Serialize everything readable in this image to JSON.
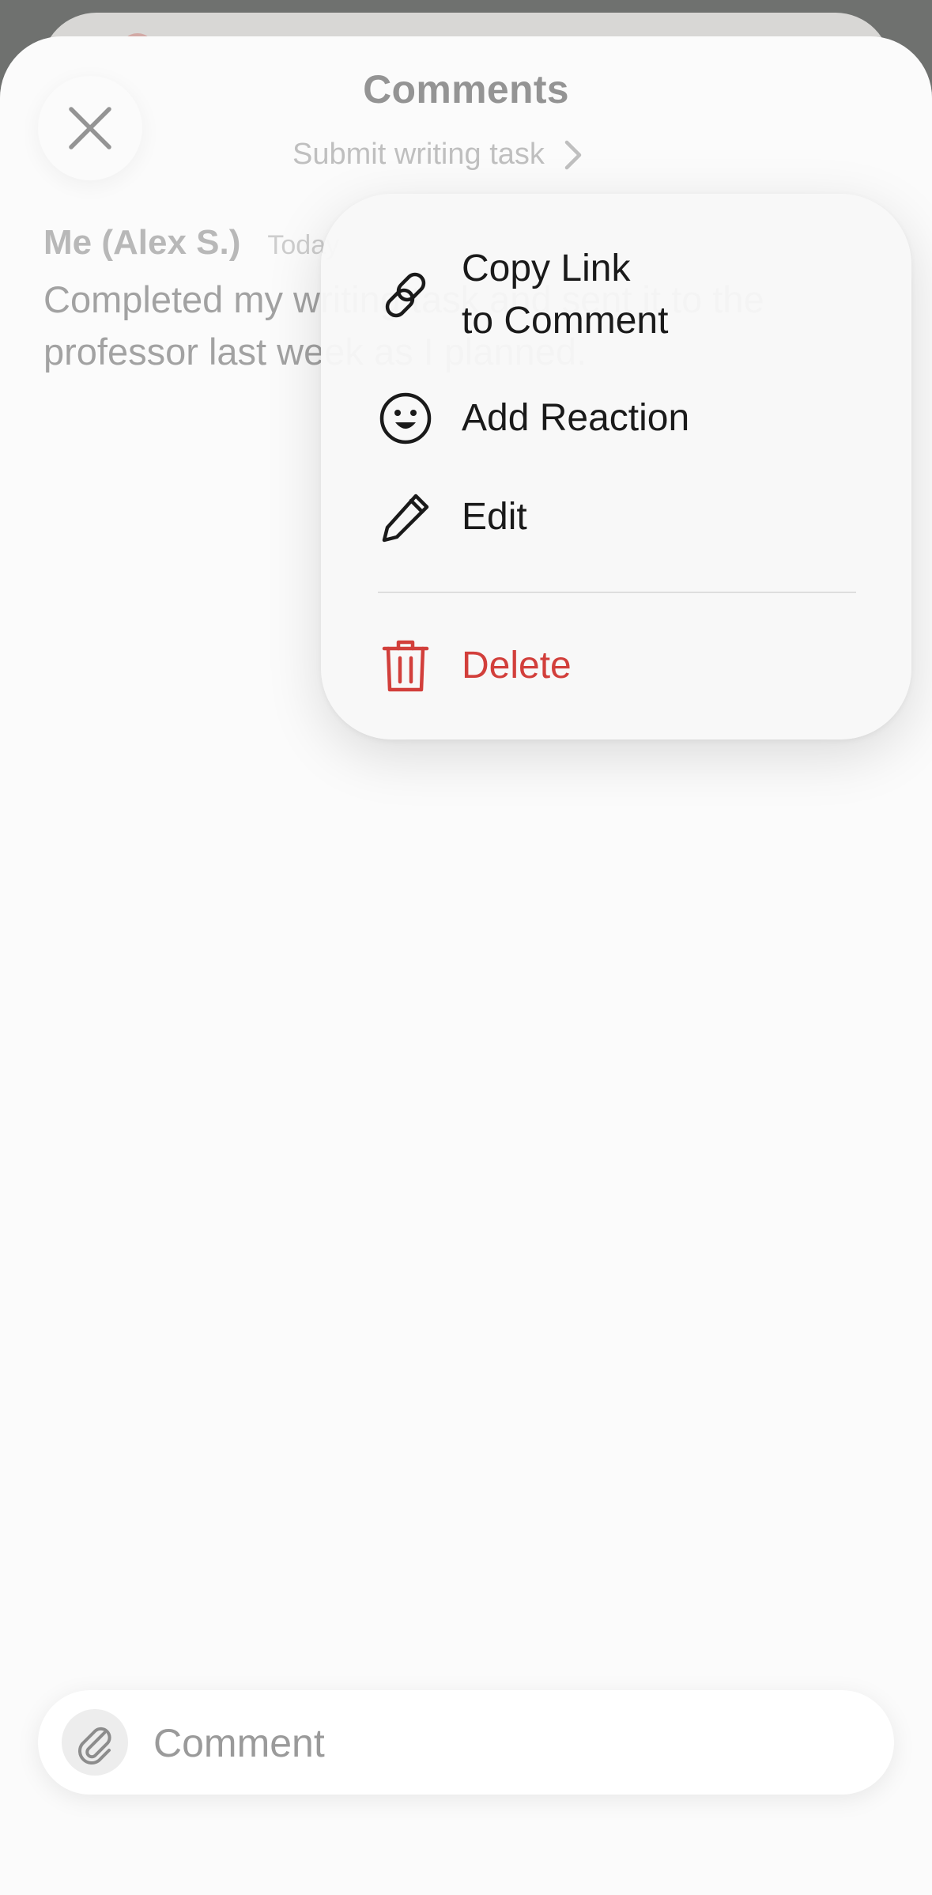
{
  "header": {
    "title": "Comments",
    "subtitle": "Submit writing task"
  },
  "comment": {
    "author": "Me (Alex S.)",
    "timestamp": "Today",
    "text": "Completed my writing task and sent it to the professor last week as I planned."
  },
  "context_menu": {
    "items": [
      {
        "label": "Copy Link\nto Comment",
        "icon": "link-icon"
      },
      {
        "label": "Add Reaction",
        "icon": "smiley-icon"
      },
      {
        "label": "Edit",
        "icon": "pencil-icon"
      },
      {
        "label": "Delete",
        "icon": "trash-icon",
        "destructive": true
      }
    ]
  },
  "composer": {
    "placeholder": "Comment"
  },
  "colors": {
    "destructive": "#d23f3b",
    "backdrop": "#6f716f"
  }
}
